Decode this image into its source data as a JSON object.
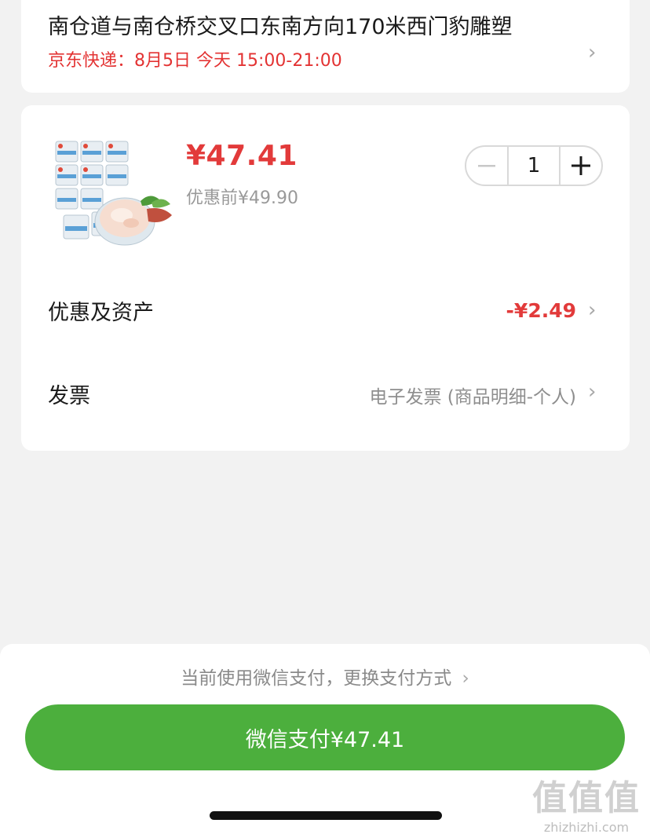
{
  "address": {
    "text": "南仓道与南仓桥交叉口东南方向170米西门豹雕塑",
    "delivery": "京东快递：8月5日 今天 15:00-21:00"
  },
  "product": {
    "price": "¥47.41",
    "original_price": "优惠前¥49.90",
    "quantity": "1",
    "image_icon": "product-thumbnail"
  },
  "rows": {
    "discount_label": "优惠及资产",
    "discount_value": "-¥2.49",
    "invoice_label": "发票",
    "invoice_value": "电子发票 (商品明细-个人)"
  },
  "payment": {
    "method_text": "当前使用微信支付，更换支付方式",
    "pay_button": "微信支付¥47.41"
  },
  "watermark": {
    "mark": "值值值",
    "site": "zhizhizhi.com"
  },
  "colors": {
    "accent_red": "#e23a3a",
    "pay_green": "#4caf3d"
  }
}
